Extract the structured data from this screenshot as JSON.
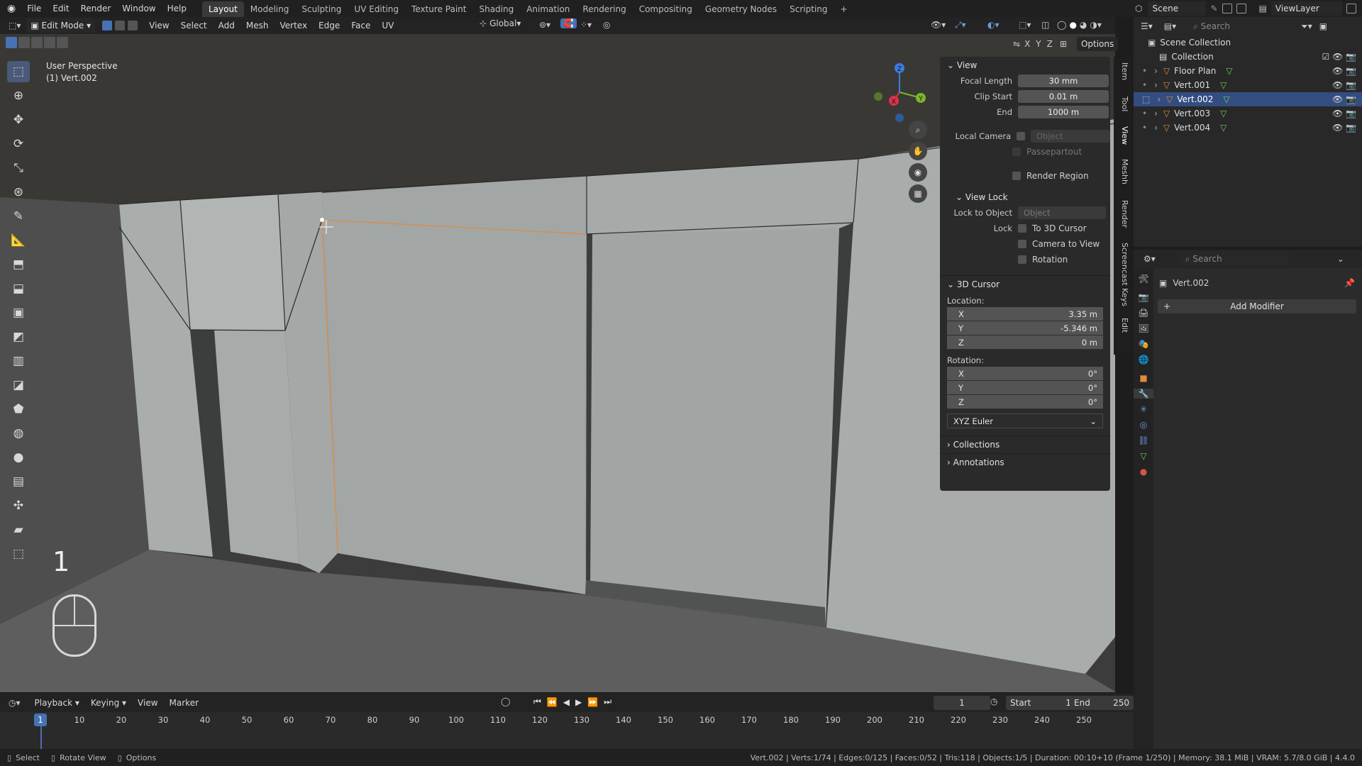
{
  "topbar": {
    "menus": [
      "File",
      "Edit",
      "Render",
      "Window",
      "Help"
    ],
    "workspaces": [
      "Layout",
      "Modeling",
      "Sculpting",
      "UV Editing",
      "Texture Paint",
      "Shading",
      "Animation",
      "Rendering",
      "Compositing",
      "Geometry Nodes",
      "Scripting"
    ],
    "active_workspace": "Layout",
    "add_tab": "+",
    "scene_label": "Scene",
    "viewlayer_label": "ViewLayer"
  },
  "vp_header": {
    "mode": "Edit Mode",
    "menus": [
      "View",
      "Select",
      "Add",
      "Mesh",
      "Vertex",
      "Edge",
      "Face",
      "UV"
    ],
    "transform_orientation": "Global",
    "axis_x": "X",
    "axis_y": "Y",
    "axis_z": "Z",
    "options": "Options"
  },
  "viewport": {
    "perspective_label": "User Perspective",
    "object_label": "(1) Vert.002",
    "overlay_number": "1",
    "gizmo": {
      "x": "X",
      "y": "Y",
      "z": "Z"
    }
  },
  "npanel": {
    "view_header": "View",
    "focal_length_label": "Focal Length",
    "focal_length": "30 mm",
    "clip_start_label": "Clip Start",
    "clip_start": "0.01 m",
    "end_label": "End",
    "end": "1000 m",
    "local_camera_label": "Local Camera",
    "local_camera_placeholder": "Object",
    "passepartout": "Passepartout",
    "render_region": "Render Region",
    "view_lock_header": "View Lock",
    "lock_to_object_label": "Lock to Object",
    "lock_to_object_placeholder": "Object",
    "lock_label": "Lock",
    "to_3d_cursor": "To 3D Cursor",
    "camera_to_view": "Camera to View",
    "rotation_cb": "Rotation",
    "cursor_header": "3D Cursor",
    "location_label": "Location:",
    "loc": [
      {
        "axis": "X",
        "value": "3.35 m"
      },
      {
        "axis": "Y",
        "value": "-5.346 m"
      },
      {
        "axis": "Z",
        "value": "0 m"
      }
    ],
    "rotation_label": "Rotation:",
    "rot": [
      {
        "axis": "X",
        "value": "0°"
      },
      {
        "axis": "Y",
        "value": "0°"
      },
      {
        "axis": "Z",
        "value": "0°"
      }
    ],
    "euler": "XYZ Euler",
    "collections": "Collections",
    "annotations": "Annotations"
  },
  "side_tabs": [
    "Item",
    "Tool",
    "View",
    "Meshh",
    "Render",
    "Screencast Keys",
    "Edit"
  ],
  "outliner": {
    "search_placeholder": "Search",
    "scene_collection": "Scene Collection",
    "collection": "Collection",
    "items": [
      {
        "name": "Floor Plan",
        "selected": false
      },
      {
        "name": "Vert.001",
        "selected": false
      },
      {
        "name": "Vert.002",
        "selected": true
      },
      {
        "name": "Vert.003",
        "selected": false
      },
      {
        "name": "Vert.004",
        "selected": false
      }
    ]
  },
  "properties": {
    "search_placeholder": "Search",
    "object_name": "Vert.002",
    "add_modifier": "Add Modifier"
  },
  "timeline": {
    "menus": [
      "Playback",
      "Keying",
      "View",
      "Marker"
    ],
    "current_frame": "1",
    "start_label": "Start",
    "start": "1",
    "end_label": "End",
    "end": "250",
    "ticks": [
      "10",
      "20",
      "30",
      "40",
      "50",
      "60",
      "70",
      "80",
      "90",
      "100",
      "110",
      "120",
      "130",
      "140",
      "150",
      "160",
      "170",
      "180",
      "190",
      "200",
      "210",
      "220",
      "230",
      "240",
      "250"
    ],
    "playhead": "1"
  },
  "statusbar": {
    "select": "Select",
    "rotate_view": "Rotate View",
    "options": "Options",
    "stats": "Vert.002 | Verts:1/74 | Edges:0/125 | Faces:0/52 | Tris:118 | Objects:1/5 | Duration: 00:10+10 (Frame 1/250) | Memory: 38.1 MiB | VRAM: 5.7/8.0 GiB | 4.4.0"
  },
  "colors": {
    "accent": "#4772b3",
    "selection_orange": "#e08a3c",
    "selected_row": "#334d80"
  }
}
